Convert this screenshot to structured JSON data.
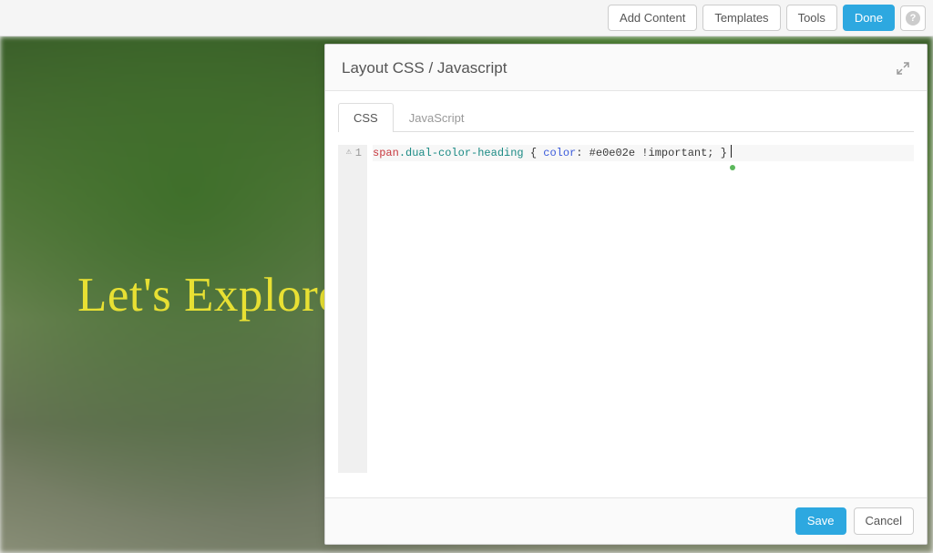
{
  "toolbar": {
    "add_content": "Add Content",
    "templates": "Templates",
    "tools": "Tools",
    "done": "Done",
    "help_glyph": "?"
  },
  "hero": {
    "heading": "Let's Explore"
  },
  "modal": {
    "title": "Layout CSS / Javascript",
    "tabs": {
      "css": "CSS",
      "js": "JavaScript"
    },
    "active_tab": "css",
    "editor": {
      "line_number": "1",
      "warn_glyph": "⚠",
      "code_tag": "span",
      "code_class": ".dual-color-heading",
      "code_open": " { ",
      "code_prop": "color",
      "code_colon": ": ",
      "code_val": "#e0e02e",
      "code_important": " !important; ",
      "code_close": "}"
    },
    "footer": {
      "save": "Save",
      "cancel": "Cancel"
    }
  }
}
